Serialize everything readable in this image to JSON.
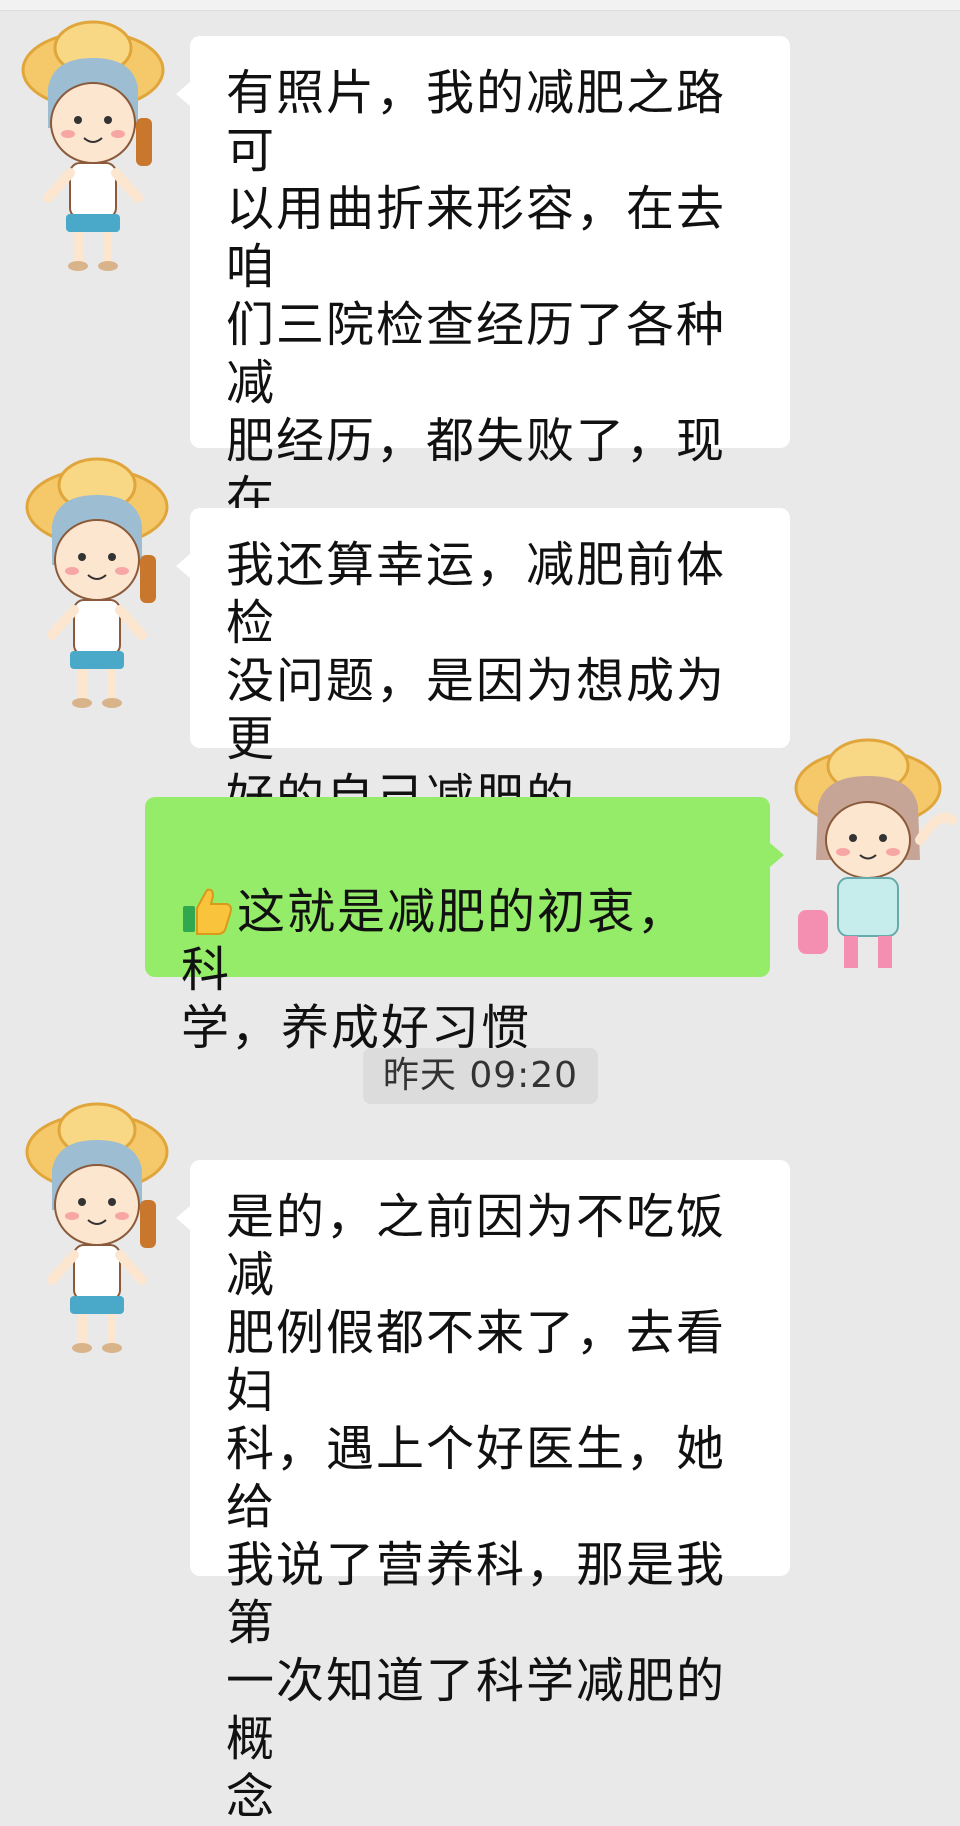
{
  "chat": {
    "messages": [
      {
        "side": "left",
        "avatar": "boy-with-hat-avatar",
        "text": "有照片，我的减肥之路可\n以用曲折来形容，在去咱\n们三院检查经历了各种减\n肥经历，都失败了，现在\n成功了，最主要养成了好\n的生活习惯"
      },
      {
        "side": "left",
        "avatar": "boy-with-hat-avatar",
        "text": "我还算幸运，减肥前体检\n没问题，是因为想成为更\n好的自己减肥的"
      },
      {
        "side": "right",
        "avatar": "girl-with-hat-avatar",
        "emoji": "thumbs-up-icon",
        "text": "这就是减肥的初衷，科\n学，养成好习惯"
      },
      {
        "side": "left",
        "avatar": "boy-with-hat-avatar",
        "text": "是的，之前因为不吃饭减\n肥例假都不来了，去看妇\n科，遇上个好医生，她给\n我说了营养科，那是我第\n一次知道了科学减肥的概\n念"
      }
    ],
    "timestamp": "昨天 09:20"
  },
  "colors": {
    "background": "#e9e9e9",
    "incoming_bubble": "#ffffff",
    "outgoing_bubble": "#95ec69",
    "timestamp_chip": "#dcdcdc"
  }
}
